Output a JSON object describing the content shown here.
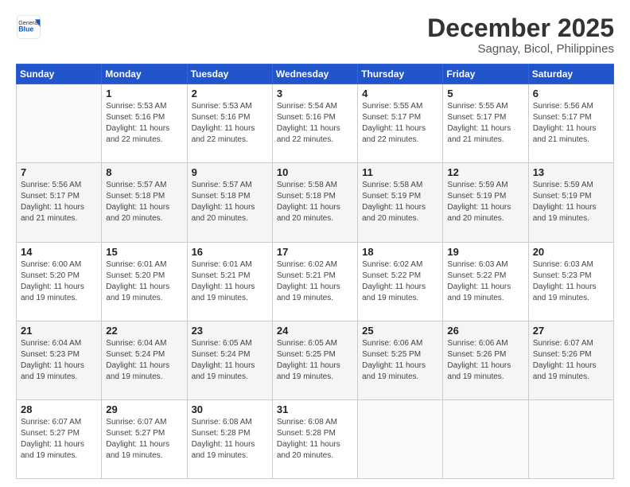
{
  "logo": {
    "general": "General",
    "blue": "Blue"
  },
  "title": "December 2025",
  "location": "Sagnay, Bicol, Philippines",
  "days": [
    "Sunday",
    "Monday",
    "Tuesday",
    "Wednesday",
    "Thursday",
    "Friday",
    "Saturday"
  ],
  "weeks": [
    [
      {
        "date": "",
        "info": ""
      },
      {
        "date": "1",
        "info": "Sunrise: 5:53 AM\nSunset: 5:16 PM\nDaylight: 11 hours\nand 22 minutes."
      },
      {
        "date": "2",
        "info": "Sunrise: 5:53 AM\nSunset: 5:16 PM\nDaylight: 11 hours\nand 22 minutes."
      },
      {
        "date": "3",
        "info": "Sunrise: 5:54 AM\nSunset: 5:16 PM\nDaylight: 11 hours\nand 22 minutes."
      },
      {
        "date": "4",
        "info": "Sunrise: 5:55 AM\nSunset: 5:17 PM\nDaylight: 11 hours\nand 22 minutes."
      },
      {
        "date": "5",
        "info": "Sunrise: 5:55 AM\nSunset: 5:17 PM\nDaylight: 11 hours\nand 21 minutes."
      },
      {
        "date": "6",
        "info": "Sunrise: 5:56 AM\nSunset: 5:17 PM\nDaylight: 11 hours\nand 21 minutes."
      }
    ],
    [
      {
        "date": "7",
        "info": "Sunrise: 5:56 AM\nSunset: 5:17 PM\nDaylight: 11 hours\nand 21 minutes."
      },
      {
        "date": "8",
        "info": "Sunrise: 5:57 AM\nSunset: 5:18 PM\nDaylight: 11 hours\nand 20 minutes."
      },
      {
        "date": "9",
        "info": "Sunrise: 5:57 AM\nSunset: 5:18 PM\nDaylight: 11 hours\nand 20 minutes."
      },
      {
        "date": "10",
        "info": "Sunrise: 5:58 AM\nSunset: 5:18 PM\nDaylight: 11 hours\nand 20 minutes."
      },
      {
        "date": "11",
        "info": "Sunrise: 5:58 AM\nSunset: 5:19 PM\nDaylight: 11 hours\nand 20 minutes."
      },
      {
        "date": "12",
        "info": "Sunrise: 5:59 AM\nSunset: 5:19 PM\nDaylight: 11 hours\nand 20 minutes."
      },
      {
        "date": "13",
        "info": "Sunrise: 5:59 AM\nSunset: 5:19 PM\nDaylight: 11 hours\nand 19 minutes."
      }
    ],
    [
      {
        "date": "14",
        "info": "Sunrise: 6:00 AM\nSunset: 5:20 PM\nDaylight: 11 hours\nand 19 minutes."
      },
      {
        "date": "15",
        "info": "Sunrise: 6:01 AM\nSunset: 5:20 PM\nDaylight: 11 hours\nand 19 minutes."
      },
      {
        "date": "16",
        "info": "Sunrise: 6:01 AM\nSunset: 5:21 PM\nDaylight: 11 hours\nand 19 minutes."
      },
      {
        "date": "17",
        "info": "Sunrise: 6:02 AM\nSunset: 5:21 PM\nDaylight: 11 hours\nand 19 minutes."
      },
      {
        "date": "18",
        "info": "Sunrise: 6:02 AM\nSunset: 5:22 PM\nDaylight: 11 hours\nand 19 minutes."
      },
      {
        "date": "19",
        "info": "Sunrise: 6:03 AM\nSunset: 5:22 PM\nDaylight: 11 hours\nand 19 minutes."
      },
      {
        "date": "20",
        "info": "Sunrise: 6:03 AM\nSunset: 5:23 PM\nDaylight: 11 hours\nand 19 minutes."
      }
    ],
    [
      {
        "date": "21",
        "info": "Sunrise: 6:04 AM\nSunset: 5:23 PM\nDaylight: 11 hours\nand 19 minutes."
      },
      {
        "date": "22",
        "info": "Sunrise: 6:04 AM\nSunset: 5:24 PM\nDaylight: 11 hours\nand 19 minutes."
      },
      {
        "date": "23",
        "info": "Sunrise: 6:05 AM\nSunset: 5:24 PM\nDaylight: 11 hours\nand 19 minutes."
      },
      {
        "date": "24",
        "info": "Sunrise: 6:05 AM\nSunset: 5:25 PM\nDaylight: 11 hours\nand 19 minutes."
      },
      {
        "date": "25",
        "info": "Sunrise: 6:06 AM\nSunset: 5:25 PM\nDaylight: 11 hours\nand 19 minutes."
      },
      {
        "date": "26",
        "info": "Sunrise: 6:06 AM\nSunset: 5:26 PM\nDaylight: 11 hours\nand 19 minutes."
      },
      {
        "date": "27",
        "info": "Sunrise: 6:07 AM\nSunset: 5:26 PM\nDaylight: 11 hours\nand 19 minutes."
      }
    ],
    [
      {
        "date": "28",
        "info": "Sunrise: 6:07 AM\nSunset: 5:27 PM\nDaylight: 11 hours\nand 19 minutes."
      },
      {
        "date": "29",
        "info": "Sunrise: 6:07 AM\nSunset: 5:27 PM\nDaylight: 11 hours\nand 19 minutes."
      },
      {
        "date": "30",
        "info": "Sunrise: 6:08 AM\nSunset: 5:28 PM\nDaylight: 11 hours\nand 19 minutes."
      },
      {
        "date": "31",
        "info": "Sunrise: 6:08 AM\nSunset: 5:28 PM\nDaylight: 11 hours\nand 20 minutes."
      },
      {
        "date": "",
        "info": ""
      },
      {
        "date": "",
        "info": ""
      },
      {
        "date": "",
        "info": ""
      }
    ]
  ]
}
